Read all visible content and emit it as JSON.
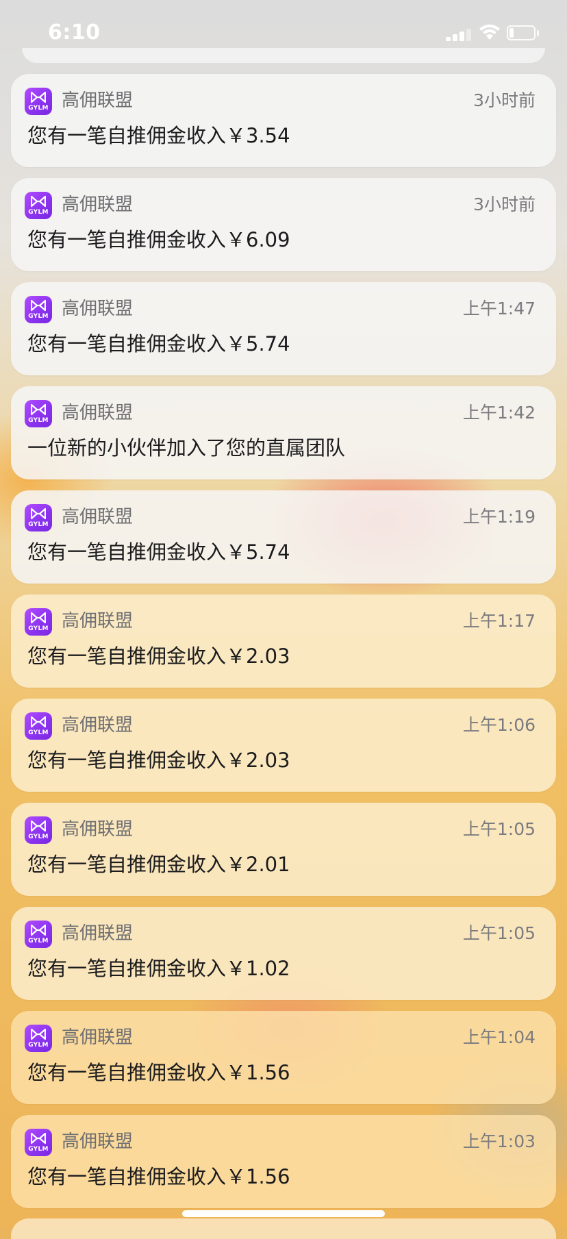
{
  "status_bar": {
    "time": "6:10",
    "icons": [
      "signal-icon",
      "wifi-icon",
      "battery-icon"
    ]
  },
  "notifications": [
    {
      "app": "高佣联盟",
      "icon_text": "GYLM",
      "time": "3小时前",
      "body": "您有一笔自推佣金收入￥3.54"
    },
    {
      "app": "高佣联盟",
      "icon_text": "GYLM",
      "time": "3小时前",
      "body": "您有一笔自推佣金收入￥6.09"
    },
    {
      "app": "高佣联盟",
      "icon_text": "GYLM",
      "time": "上午1:47",
      "body": "您有一笔自推佣金收入￥5.74"
    },
    {
      "app": "高佣联盟",
      "icon_text": "GYLM",
      "time": "上午1:42",
      "body": "一位新的小伙伴加入了您的直属团队"
    },
    {
      "app": "高佣联盟",
      "icon_text": "GYLM",
      "time": "上午1:19",
      "body": "您有一笔自推佣金收入￥5.74"
    },
    {
      "app": "高佣联盟",
      "icon_text": "GYLM",
      "time": "上午1:17",
      "body": "您有一笔自推佣金收入￥2.03"
    },
    {
      "app": "高佣联盟",
      "icon_text": "GYLM",
      "time": "上午1:06",
      "body": "您有一笔自推佣金收入￥2.03"
    },
    {
      "app": "高佣联盟",
      "icon_text": "GYLM",
      "time": "上午1:05",
      "body": "您有一笔自推佣金收入￥2.01"
    },
    {
      "app": "高佣联盟",
      "icon_text": "GYLM",
      "time": "上午1:05",
      "body": "您有一笔自推佣金收入￥1.02"
    },
    {
      "app": "高佣联盟",
      "icon_text": "GYLM",
      "time": "上午1:04",
      "body": "您有一笔自推佣金收入￥1.56"
    },
    {
      "app": "高佣联盟",
      "icon_text": "GYLM",
      "time": "上午1:03",
      "body": "您有一笔自推佣金收入￥1.56"
    }
  ],
  "colors": {
    "app_icon": "#8a32ee",
    "status_text": "#ffffff"
  }
}
